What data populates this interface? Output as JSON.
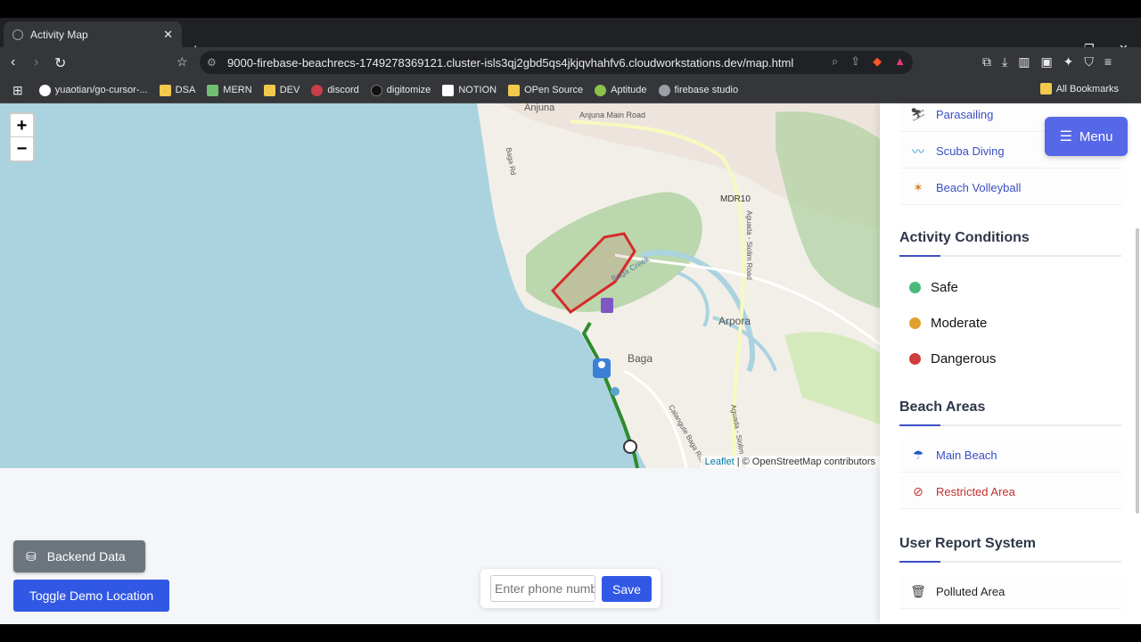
{
  "browser": {
    "tab_title": "Activity Map",
    "url": "9000-firebase-beachrecs-1749278369121.cluster-isls3qj2gbd5qs4jkjqvhahfv6.cloudworkstations.dev/map.html",
    "bookmarks": [
      "yuaotian/go-cursor-...",
      "DSA",
      "MERN",
      "DEV",
      "discord",
      "digitomize",
      "NOTION",
      "OPen Source",
      "Aptitude",
      "firebase studio"
    ],
    "all_bookmarks": "All Bookmarks"
  },
  "map": {
    "zoom_in": "+",
    "zoom_out": "−",
    "attribution_leaflet": "Leaflet",
    "attribution_rest": " | © OpenStreetMap contributors",
    "labels": [
      "Anjuna",
      "Anjuna Main Road",
      "MDR10",
      "Baga Creek",
      "Arpora",
      "Baga",
      "Calangute Baga Road",
      "Aguada - Siolim Road",
      "Aguada - Siolim Road",
      "Baga Rd"
    ],
    "colors": {
      "water": "#aad3df",
      "land": "#f2efe9",
      "green": "#add19e",
      "restricted": "#d62b2b",
      "beach_path": "#2e8b2e"
    }
  },
  "sidebar": {
    "activities": [
      {
        "icon": "parasailing-icon",
        "label": "Parasailing"
      },
      {
        "icon": "scuba-diving-icon",
        "label": "Scuba Diving"
      },
      {
        "icon": "beach-volleyball-icon",
        "label": "Beach Volleyball"
      }
    ],
    "conditions_title": "Activity Conditions",
    "conditions": [
      {
        "label": "Safe",
        "color": "#48bb78"
      },
      {
        "label": "Moderate",
        "color": "#e0a030"
      },
      {
        "label": "Dangerous",
        "color": "#d13c3c"
      }
    ],
    "beach_areas_title": "Beach Areas",
    "beach_areas": [
      {
        "icon": "umbrella-icon",
        "label": "Main Beach",
        "color": "#3b4fc4"
      },
      {
        "icon": "ban-icon",
        "label": "Restricted Area",
        "color": "#c53030"
      }
    ],
    "report_title": "User Report System",
    "reports": [
      {
        "icon": "trash-icon",
        "label": "Polluted Area"
      }
    ]
  },
  "menu_button": "Menu",
  "backend_button": "Backend Data",
  "toggle_button": "Toggle Demo Location",
  "phone": {
    "placeholder": "Enter phone number",
    "save": "Save"
  }
}
